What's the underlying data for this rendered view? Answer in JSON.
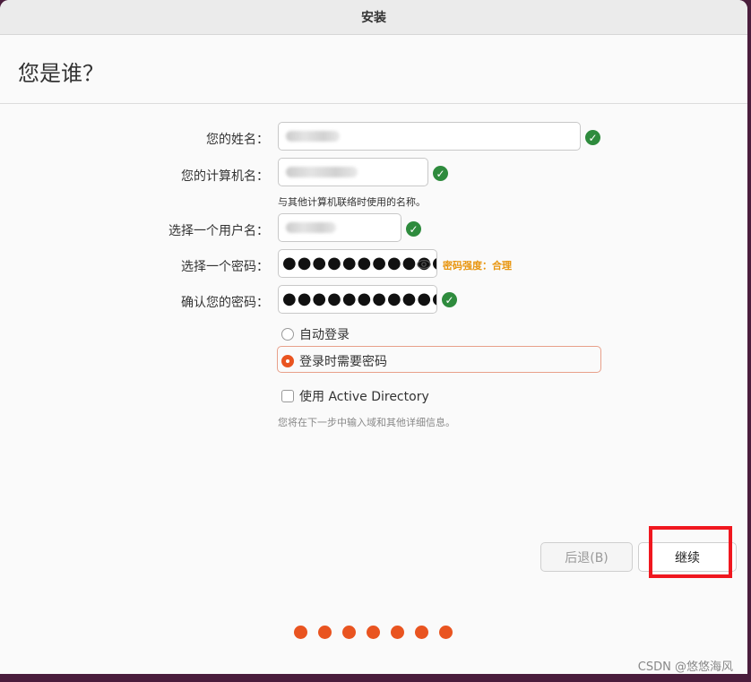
{
  "window": {
    "title": "安装"
  },
  "page": {
    "heading": "您是谁？"
  },
  "form": {
    "name_label": "您的姓名：",
    "computer_label": "您的计算机名：",
    "computer_hint": "与其他计算机联络时使用的名称。",
    "username_label": "选择一个用户名：",
    "password_label": "选择一个密码：",
    "password_value": "●●●●●●●●●●●●",
    "password_strength": "密码强度：合理",
    "confirm_label": "确认您的密码：",
    "confirm_value": "●●●●●●●●●●●●●",
    "auto_login_label": "自动登录",
    "require_password_label": "登录时需要密码",
    "login_option_selected": "登录时需要密码",
    "active_directory_label": "使用 Active Directory",
    "active_directory_checked": false,
    "active_directory_note": "您将在下一步中输入域和其他详细信息。"
  },
  "buttons": {
    "back": "后退(B)",
    "continue": "继续"
  },
  "progress": {
    "steps": 7
  },
  "watermark": "CSDN @悠悠海风",
  "colors": {
    "accent": "#e95420",
    "valid": "#2e8b3d",
    "strength": "#e8950f",
    "annotation": "#f0171f"
  }
}
